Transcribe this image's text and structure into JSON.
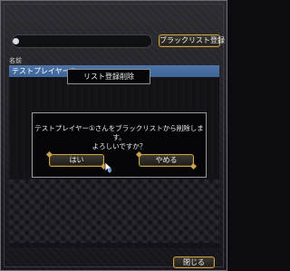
{
  "toolbar": {
    "blacklist_label": "ブラックリスト登録"
  },
  "list": {
    "column_name": "名前",
    "rows": [
      "テストプレイヤー①"
    ]
  },
  "dialog": {
    "title": "リスト登録削除",
    "message_line1": "テストプレイヤー①さんをブラックリストから削除します。",
    "message_line2": "よろしいですか？",
    "yes_label": "はい",
    "no_label": "やめる"
  },
  "footer": {
    "close_label": "閉じる"
  },
  "colors": {
    "accent_gold": "#c8a14a",
    "row_highlight": "#4d75a8"
  }
}
